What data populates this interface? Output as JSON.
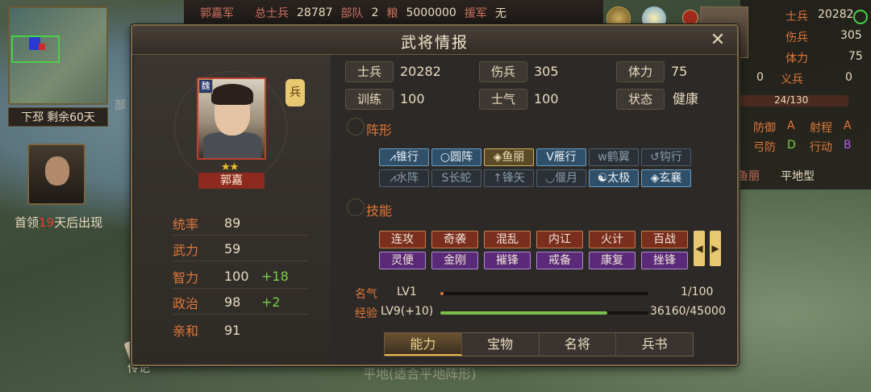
{
  "topbar": {
    "army": "郭嘉军",
    "total_label": "总士兵",
    "total": "28787",
    "units_label": "部队",
    "units": "2",
    "grain_label": "粮",
    "grain": "5000000",
    "reinforce_label": "援军",
    "reinforce": "无"
  },
  "minimap": {
    "city": "下邳",
    "remaining": "剩余60天"
  },
  "boss": {
    "pre": "首领",
    "days": "19",
    "post": "天后出现"
  },
  "bg": {
    "partial1": "部",
    "terrain": "平地(适合平地阵形)"
  },
  "biography": "传记",
  "rpanel": {
    "soldiers_label": "士兵",
    "soldiers": "20282",
    "wounded_label": "伤兵",
    "wounded": "305",
    "stamina_label": "体力",
    "stamina": "75",
    "zero1": "0",
    "militia": "义兵",
    "zero2": "0",
    "progress": "24/130",
    "defense": "防御",
    "defense_grade": "A",
    "range": "射程",
    "range_grade": "A",
    "bow_def": "弓防",
    "bow_def_grade": "D",
    "move": "行动",
    "move_grade": "B",
    "formation_partial": "鱼丽",
    "terrain": "平地型"
  },
  "dialog": {
    "title": "武将情报",
    "general": {
      "faction": "魏",
      "name": "郭嘉",
      "troop": "兵",
      "stars": "★★"
    },
    "attributes": [
      {
        "label": "统率",
        "value": "89",
        "bonus": ""
      },
      {
        "label": "武力",
        "value": "59",
        "bonus": ""
      },
      {
        "label": "智力",
        "value": "100",
        "bonus": "+18"
      },
      {
        "label": "政治",
        "value": "98",
        "bonus": "+2"
      },
      {
        "label": "亲和",
        "value": "91",
        "bonus": ""
      }
    ],
    "stats": {
      "soldiers_label": "士兵",
      "soldiers": "20282",
      "wounded_label": "伤兵",
      "wounded": "305",
      "stamina_label": "体力",
      "stamina": "75",
      "training_label": "训练",
      "training": "100",
      "morale_label": "士气",
      "morale": "100",
      "status_label": "状态",
      "status": "健康"
    },
    "formation_title": "阵形",
    "formations": [
      "锥行",
      "圆阵",
      "鱼丽",
      "雁行",
      "鹤翼",
      "钩行",
      "水阵",
      "长蛇",
      "锋矢",
      "偃月",
      "太极",
      "玄襄"
    ],
    "skills_title": "技能",
    "skills": [
      "连攻",
      "奇袭",
      "混乱",
      "内讧",
      "火计",
      "百战",
      "灵便",
      "金刚",
      "摧锋",
      "戒备",
      "康复",
      "挫锋"
    ],
    "fame": {
      "label": "名气",
      "level": "LV1",
      "value": "1/100",
      "fraction": 0.01
    },
    "exp": {
      "label": "经验",
      "level": "LV9(+10)",
      "value": "36160/45000",
      "fraction": 0.8036
    },
    "tabs": [
      "能力",
      "宝物",
      "名将",
      "兵书"
    ]
  }
}
